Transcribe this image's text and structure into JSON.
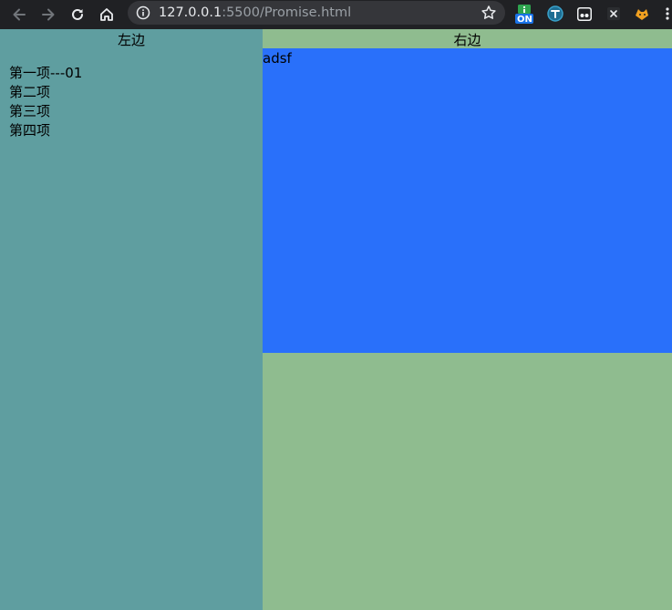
{
  "browser": {
    "url_host": "127.0.0.1",
    "url_rest": ":5500/Promise.html",
    "extensions": [
      "on-badge-extension-icon",
      "translate-extension-icon",
      "face-extension-icon",
      "x-extension-icon",
      "fox-extension-icon",
      "menu-extension-icon"
    ],
    "ext_on_label": "ON"
  },
  "left": {
    "title": "左边",
    "items": [
      "第一项---01",
      "第二项",
      "第三项",
      "第四项"
    ],
    "bg_color": "#5f9ea0"
  },
  "right": {
    "title": "右边",
    "content_text": "adsf",
    "bg_color": "#8fbc8f",
    "box_color": "#2970fa"
  }
}
